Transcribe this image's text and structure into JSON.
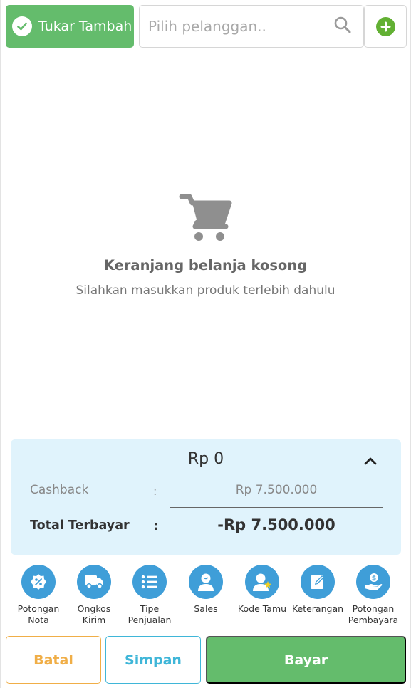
{
  "header": {
    "trade_in_label": "Tukar Tambah",
    "customer_search_placeholder": "Pilih pelanggan.."
  },
  "empty_cart": {
    "title": "Keranjang belanja kosong",
    "subtitle": "Silahkan masukkan produk terlebih dahulu"
  },
  "summary": {
    "total_amount": "Rp 0",
    "cashback_label": "Cashback",
    "cashback_colon": ":",
    "cashback_value": "Rp 7.500.000",
    "total_paid_label": "Total Terbayar",
    "total_paid_colon": ":",
    "total_paid_value": "-Rp 7.500.000"
  },
  "actions": [
    {
      "label": "Potongan\nNota",
      "icon": "discount-badge-icon"
    },
    {
      "label": "Ongkos\nKirim",
      "icon": "delivery-truck-icon"
    },
    {
      "label": "Tipe\nPenjualan",
      "icon": "list-icon"
    },
    {
      "label": "Sales",
      "icon": "user-icon"
    },
    {
      "label": "Kode Tamu",
      "icon": "guest-star-icon"
    },
    {
      "label": "Keterangan",
      "icon": "edit-note-icon"
    },
    {
      "label": "Potongan\nPembayara",
      "icon": "money-hand-icon"
    }
  ],
  "footer": {
    "cancel_label": "Batal",
    "save_label": "Simpan",
    "pay_label": "Bayar"
  },
  "colors": {
    "primary_green": "#64bc6c",
    "add_icon_green": "#62b033",
    "action_blue": "#3f9ed8",
    "summary_bg": "#e0f3fc",
    "cancel_orange": "#f0ae47",
    "save_cyan": "#3fb6d8"
  }
}
